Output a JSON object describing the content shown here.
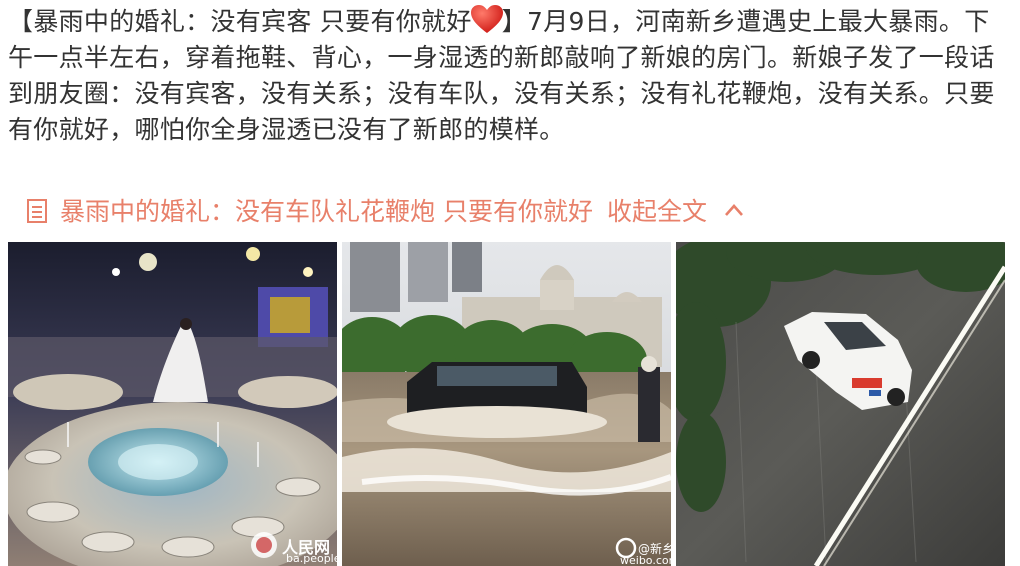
{
  "post": {
    "bracket_open": "【",
    "title_part1": "暴雨中的婚礼：没有宾客 只要有你就好",
    "bracket_close": "】",
    "body": "7月9日，河南新乡遭遇史上最大暴雨。下午一点半左右，穿着拖鞋、背心，一身湿透的新郎敲响了新娘的房门。新娘子发了一段话到朋友圈：没有宾客，没有关系；没有车队，没有关系；没有礼花鞭炮，没有关系。只要有你就好，哪怕你全身湿透已没有了新郎的模样。"
  },
  "collapse": {
    "article_title": "暴雨中的婚礼：没有车队礼花鞭炮 只要有你就好",
    "action": "收起全文"
  },
  "photos": [
    {
      "watermark": "人民网",
      "watermark_url": "ba.people"
    },
    {
      "watermark": "@新乡",
      "watermark_url": "weibo.com"
    },
    {
      "watermark": ""
    }
  ],
  "colors": {
    "text": "#333333",
    "accent": "#e8806a",
    "heart": "#e0302a"
  },
  "icons": [
    "red-heart-icon",
    "document-icon",
    "chevron-up-icon"
  ]
}
